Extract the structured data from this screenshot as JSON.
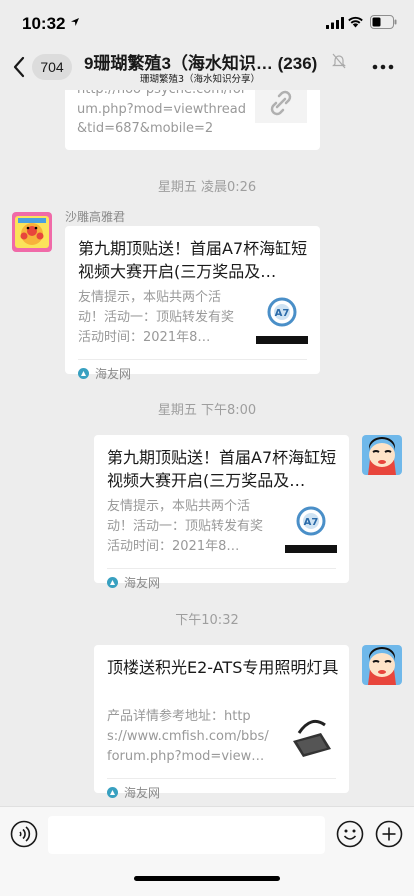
{
  "status": {
    "time": "10:32"
  },
  "nav": {
    "unread_count": "704",
    "title": "9珊瑚繁殖3（海水知识… (236)",
    "subtitle": "珊瑚繁殖3（海水知识分享）"
  },
  "chat": {
    "top_card_text": "http://hoo-psyche.com/forum.php?mod=viewthread&tid=687&mobile=2",
    "messages": [
      {
        "time": "星期五 凌晨0:26",
        "sender": "沙雕高雅君",
        "title": "第九期顶贴送！首届A7杯海缸短视频大赛开启(三万奖品及…",
        "desc": "友情提示，本贴共两个活动！活动一：顶贴转发有奖活动时间：2021年8…",
        "source": "海友网"
      },
      {
        "time": "星期五 下午8:00",
        "title": "第九期顶贴送！首届A7杯海缸短视频大赛开启(三万奖品及…",
        "desc": "友情提示，本贴共两个活动！活动一：顶贴转发有奖活动时间：2021年8…",
        "source": "海友网"
      },
      {
        "time": "下午10:32",
        "title": "顶楼送积光E2-ATS专用照明灯具",
        "desc": "产品详情参考地址：https://www.cmfish.com/bbs/forum.php?mod=viewthr…",
        "source": "海友网"
      }
    ]
  },
  "colors": {
    "background": "#ededed",
    "card": "#ffffff",
    "muted_text": "#999999"
  }
}
